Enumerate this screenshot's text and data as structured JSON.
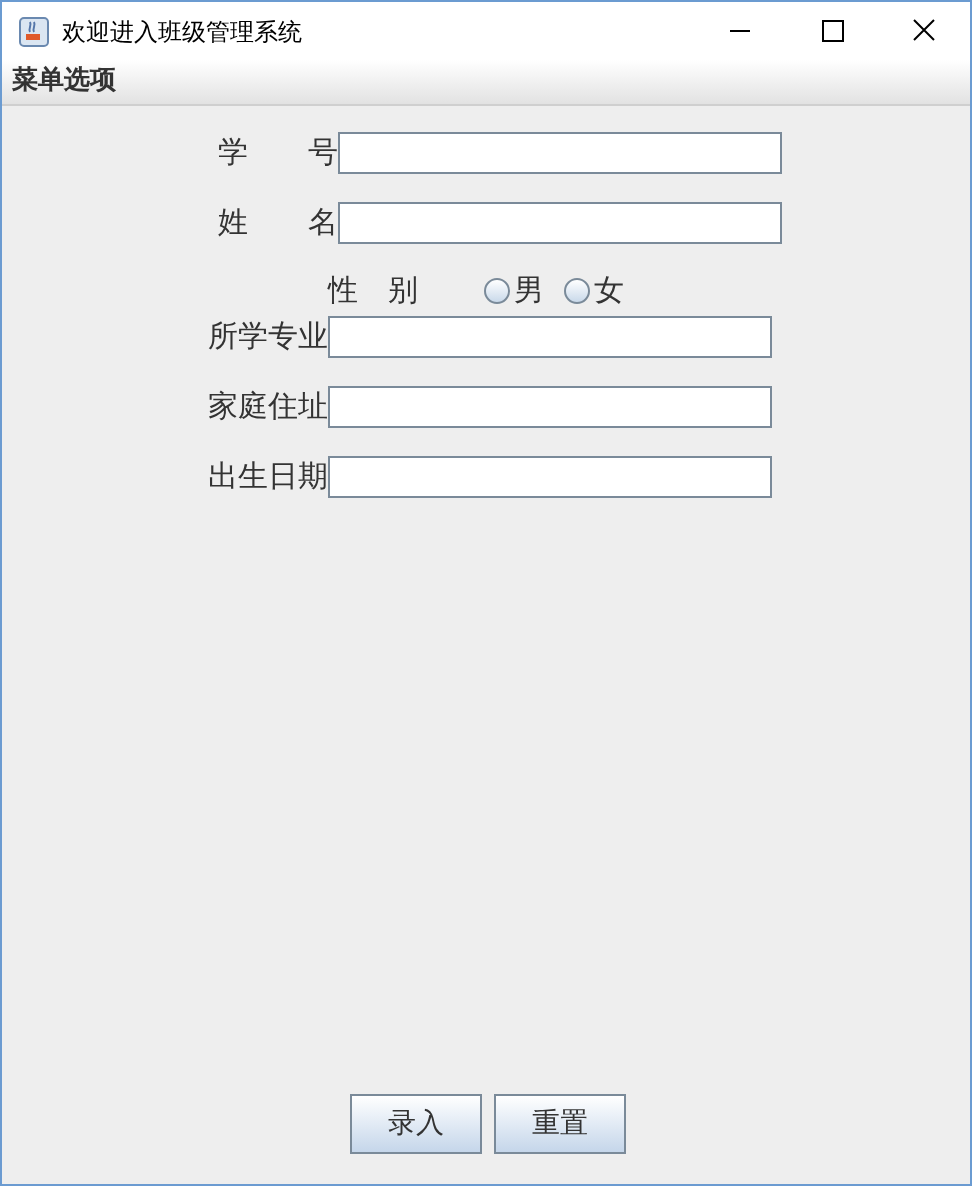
{
  "window": {
    "title": "欢迎进入班级管理系统"
  },
  "menu": [
    "菜单选项"
  ],
  "top_fields": [
    {
      "label": "学　　号"
    },
    {
      "label": "姓　　名"
    }
  ],
  "gender": {
    "label": "性　别",
    "options": [
      {
        "label": "男",
        "selected": false
      },
      {
        "label": "女",
        "selected": false
      }
    ]
  },
  "fields": [
    {
      "label": "所学专业"
    },
    {
      "label": "家庭住址"
    },
    {
      "label": "出生日期"
    }
  ],
  "buttons": [
    "录入",
    "重置"
  ]
}
